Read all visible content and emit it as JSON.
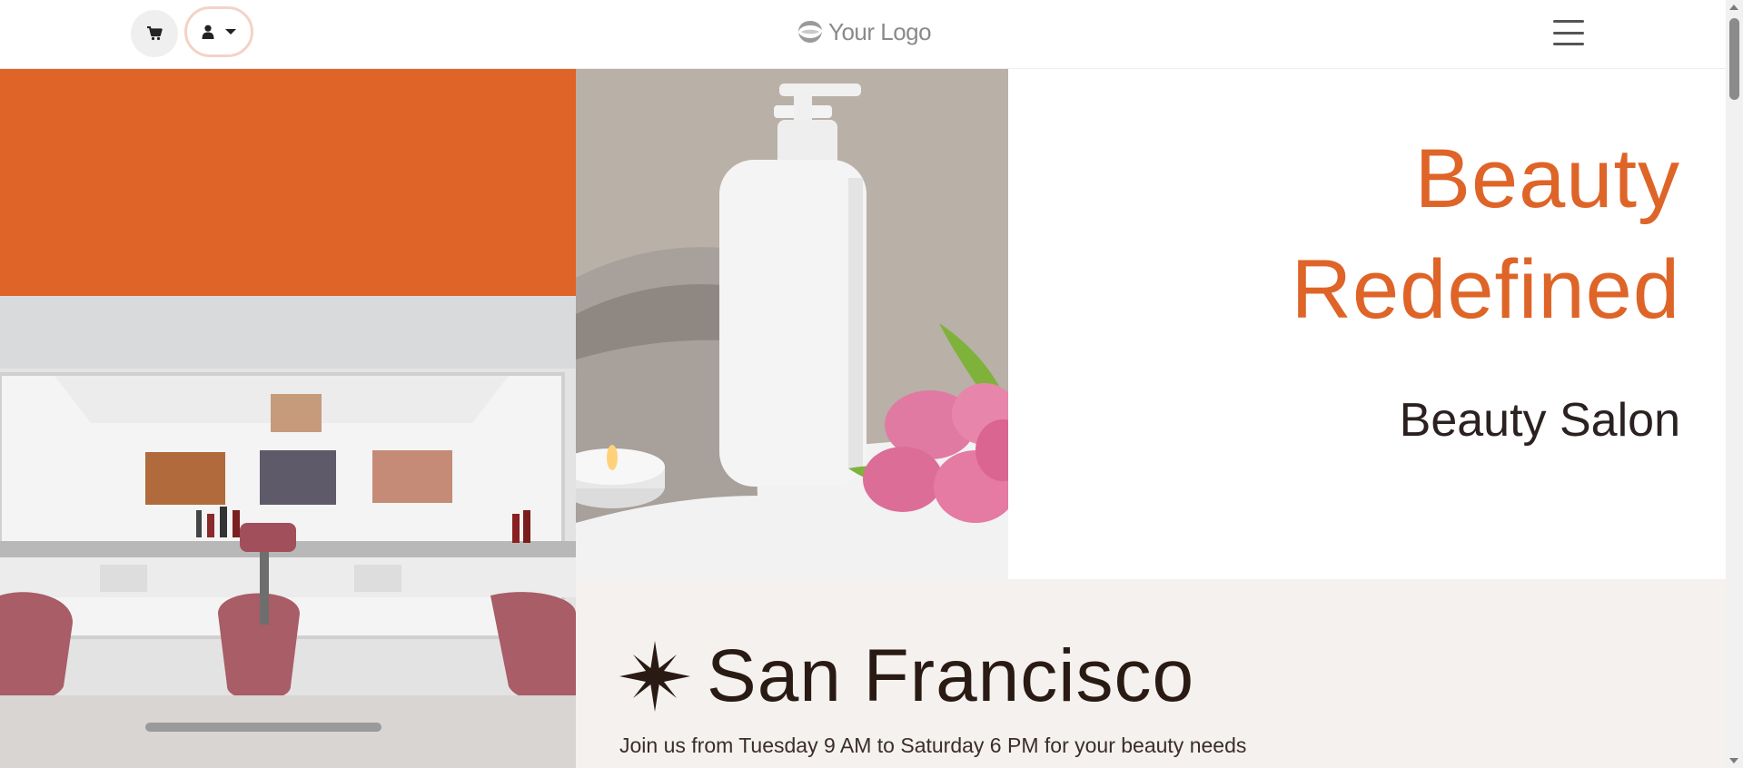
{
  "header": {
    "logo_text": "Your Logo",
    "cart_icon": "shopping-cart-icon",
    "user_icon": "user-icon",
    "dropdown_icon": "caret-down-icon",
    "menu_icon": "hamburger-menu-icon"
  },
  "hero": {
    "title_line1": "Beauty",
    "title_line2": "Redefined",
    "subtitle": "Beauty Salon",
    "images": [
      "salon-interior-photo",
      "lotion-bottle-spa-photo"
    ]
  },
  "location": {
    "icon": "star-burst-icon",
    "city": "San Francisco",
    "hours_text": "Join us from Tuesday 9 AM to Saturday 6 PM for your beauty needs"
  },
  "colors": {
    "accent": "#de6428",
    "panel_bg": "#f4f1ee",
    "dark_text": "#2a1a14"
  }
}
